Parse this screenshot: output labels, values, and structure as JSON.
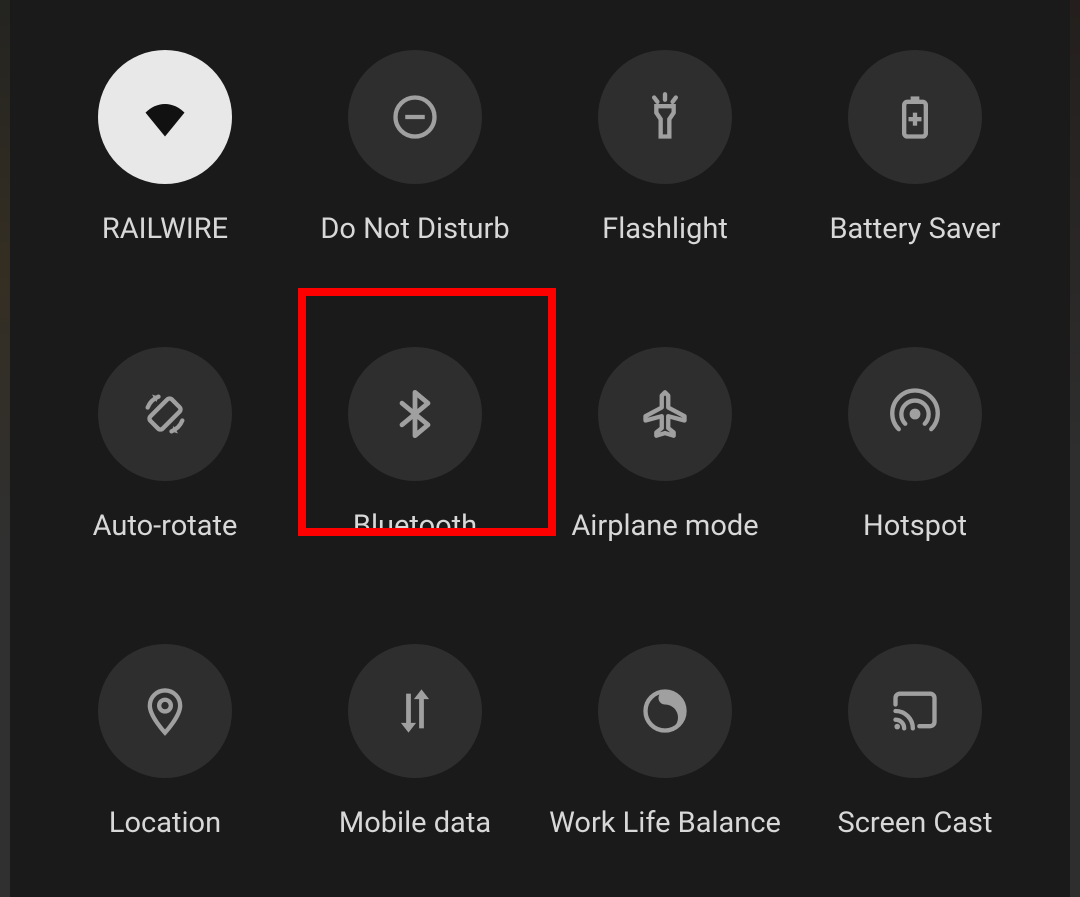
{
  "tiles": [
    {
      "id": "wifi",
      "label": "RAILWIRE",
      "icon": "wifi-icon",
      "active": true
    },
    {
      "id": "dnd",
      "label": "Do Not Disturb",
      "icon": "dnd-icon",
      "active": false
    },
    {
      "id": "flashlight",
      "label": "Flashlight",
      "icon": "flashlight-icon",
      "active": false
    },
    {
      "id": "battery-saver",
      "label": "Battery Saver",
      "icon": "battery-saver-icon",
      "active": false
    },
    {
      "id": "auto-rotate",
      "label": "Auto-rotate",
      "icon": "auto-rotate-icon",
      "active": false
    },
    {
      "id": "bluetooth",
      "label": "Bluetooth",
      "icon": "bluetooth-icon",
      "active": false
    },
    {
      "id": "airplane-mode",
      "label": "Airplane mode",
      "icon": "airplane-icon",
      "active": false
    },
    {
      "id": "hotspot",
      "label": "Hotspot",
      "icon": "hotspot-icon",
      "active": false
    },
    {
      "id": "location",
      "label": "Location",
      "icon": "location-icon",
      "active": false
    },
    {
      "id": "mobile-data",
      "label": "Mobile data",
      "icon": "mobile-data-icon",
      "active": false
    },
    {
      "id": "work-life",
      "label": "Work Life Balance",
      "icon": "work-life-icon",
      "active": false
    },
    {
      "id": "screen-cast",
      "label": "Screen Cast",
      "icon": "screen-cast-icon",
      "active": false
    }
  ],
  "highlighted_tile": "bluetooth"
}
